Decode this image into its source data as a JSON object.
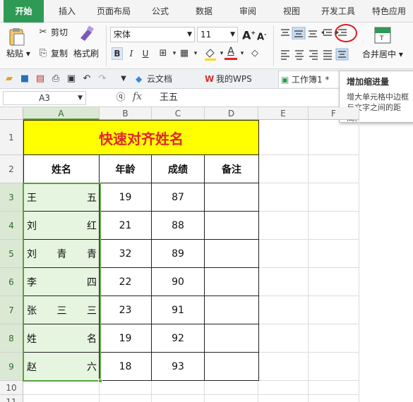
{
  "menu": {
    "tabs": [
      "开始",
      "插入",
      "页面布局",
      "公式",
      "数据",
      "审阅",
      "视图",
      "开发工具",
      "特色应用"
    ]
  },
  "ribbon": {
    "paste": "粘贴",
    "cut": "剪切",
    "copy": "复制",
    "format_painter": "格式刷",
    "font_name": "宋体",
    "font_size": "11",
    "merge_center": "合并居中",
    "bold": "B",
    "italic": "I",
    "underline": "U",
    "font_grow": "A",
    "font_shrink": "A",
    "font_color_letter": "A"
  },
  "quickbar": {
    "doc_tabs": [
      "云文档",
      "我的WPS",
      "工作簿1 *"
    ]
  },
  "tooltip": {
    "title": "增加缩进量",
    "body": "增大单元格中边框与文字之间的距离。"
  },
  "formula_bar": {
    "cell_ref": "A3",
    "fx": "fx",
    "content": "王五"
  },
  "columns": [
    "A",
    "B",
    "C",
    "D",
    "E",
    "F"
  ],
  "rows": [
    "1",
    "2",
    "3",
    "4",
    "5",
    "6",
    "7",
    "8",
    "9",
    "10",
    "11"
  ],
  "table": {
    "title": "快速对齐姓名",
    "headers": [
      "姓名",
      "年龄",
      "成绩",
      "备注"
    ],
    "records": [
      {
        "name_first": "王",
        "name_mid": "",
        "name_last": "五",
        "age": "19",
        "score": "87"
      },
      {
        "name_first": "刘",
        "name_mid": "",
        "name_last": "红",
        "age": "21",
        "score": "88"
      },
      {
        "name_first": "刘",
        "name_mid": "青",
        "name_last": "青",
        "age": "32",
        "score": "89"
      },
      {
        "name_first": "李",
        "name_mid": "",
        "name_last": "四",
        "age": "22",
        "score": "90"
      },
      {
        "name_first": "张",
        "name_mid": "三",
        "name_last": "三",
        "age": "23",
        "score": "91"
      },
      {
        "name_first": "姓",
        "name_mid": "",
        "name_last": "名",
        "age": "19",
        "score": "92"
      },
      {
        "name_first": "赵",
        "name_mid": "",
        "name_last": "六",
        "age": "18",
        "score": "93"
      }
    ]
  },
  "colors": {
    "accent_green": "#2f9a55",
    "title_bg": "#ffff00",
    "title_text": "#e0262a",
    "selection_fill": "#e6f5e0",
    "selection_border": "#5aa040",
    "annotation_red": "#d81e1e"
  }
}
